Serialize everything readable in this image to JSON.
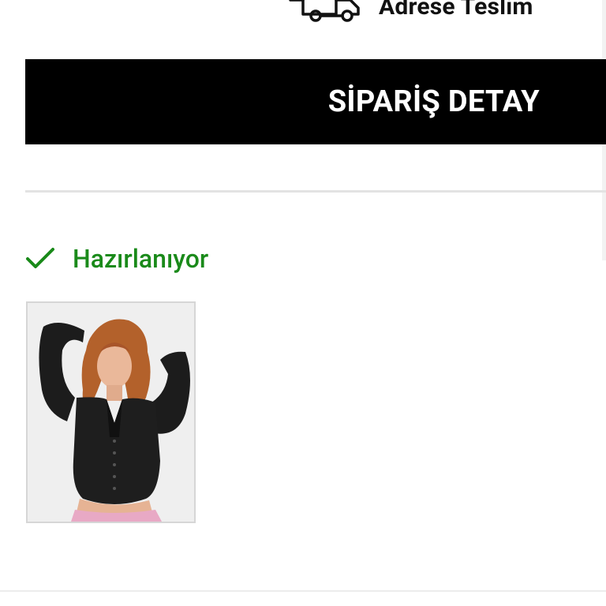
{
  "delivery": {
    "icon": "truck-icon",
    "label": "Adrese Teslim"
  },
  "order_detail": {
    "label": "SİPARİŞ DETAY"
  },
  "status": {
    "icon": "check-icon",
    "label": "Hazırlanıyor",
    "color": "#1a8a1a"
  },
  "product": {
    "image": "product-photo-woman-black-cardigan"
  },
  "colors": {
    "primary_bar": "#000000",
    "success": "#1a8a1a"
  }
}
